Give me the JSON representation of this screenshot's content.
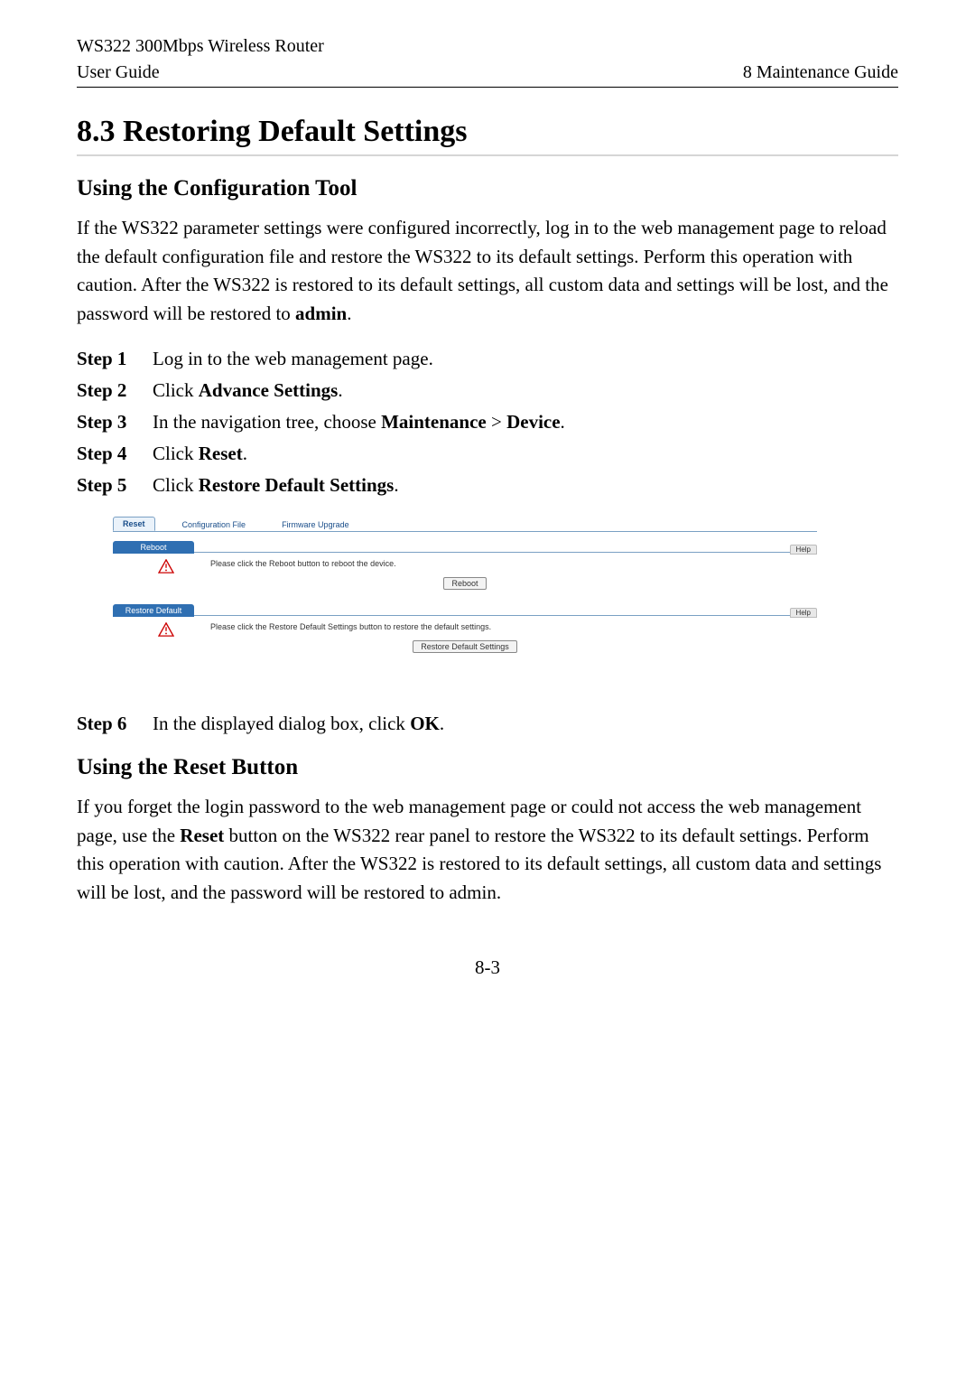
{
  "header": {
    "product": "WS322 300Mbps Wireless Router",
    "left": "User Guide",
    "right": "8 Maintenance Guide"
  },
  "section": {
    "title": "8.3 Restoring Default Settings"
  },
  "part1": {
    "heading": "Using the Configuration Tool",
    "intro_before": "If the WS322 parameter settings were configured incorrectly, log in to the web management page to reload the default configuration file and restore the WS322 to its default settings. Perform this operation with caution. After the WS322 is restored to its default settings, all custom data and settings will be lost, and the password will be restored to ",
    "intro_bold": "admin",
    "intro_after": "."
  },
  "steps_a": [
    {
      "label": "Step 1",
      "text": "Log in to the web management page."
    },
    {
      "label": "Step 2",
      "prefix": "Click ",
      "bold": "Advance Settings",
      "suffix": "."
    },
    {
      "label": "Step 3",
      "prefix": "In the navigation tree, choose ",
      "bold": "Maintenance",
      "mid": " > ",
      "bold2": "Device",
      "suffix": "."
    },
    {
      "label": "Step 4",
      "prefix": "Click ",
      "bold": "Reset",
      "suffix": "."
    },
    {
      "label": "Step 5",
      "prefix": "Click ",
      "bold": "Restore Default Settings",
      "suffix": "."
    }
  ],
  "ui": {
    "tabs": {
      "reset": "Reset",
      "config": "Configuration File",
      "firmware": "Firmware Upgrade"
    },
    "reboot": {
      "badge": "Reboot",
      "help": "Help",
      "desc": "Please click the Reboot button to reboot the device.",
      "button": "Reboot"
    },
    "restore": {
      "badge": "Restore Default",
      "help": "Help",
      "desc": "Please click the Restore Default Settings button to restore the default settings.",
      "button": "Restore Default Settings"
    }
  },
  "steps_b": [
    {
      "label": "Step 6",
      "prefix": "In the displayed dialog box, click ",
      "bold": "OK",
      "suffix": "."
    }
  ],
  "part2": {
    "heading": "Using the Reset Button",
    "body_before": "If you forget the login password to the web management page or could not access the web management page, use the ",
    "body_bold": "Reset",
    "body_after": " button on the WS322 rear panel to restore the WS322 to its default settings. Perform this operation with caution. After the WS322 is restored to its default settings, all custom data and settings will be lost, and the password will be restored to admin."
  },
  "page_number": "8-3"
}
